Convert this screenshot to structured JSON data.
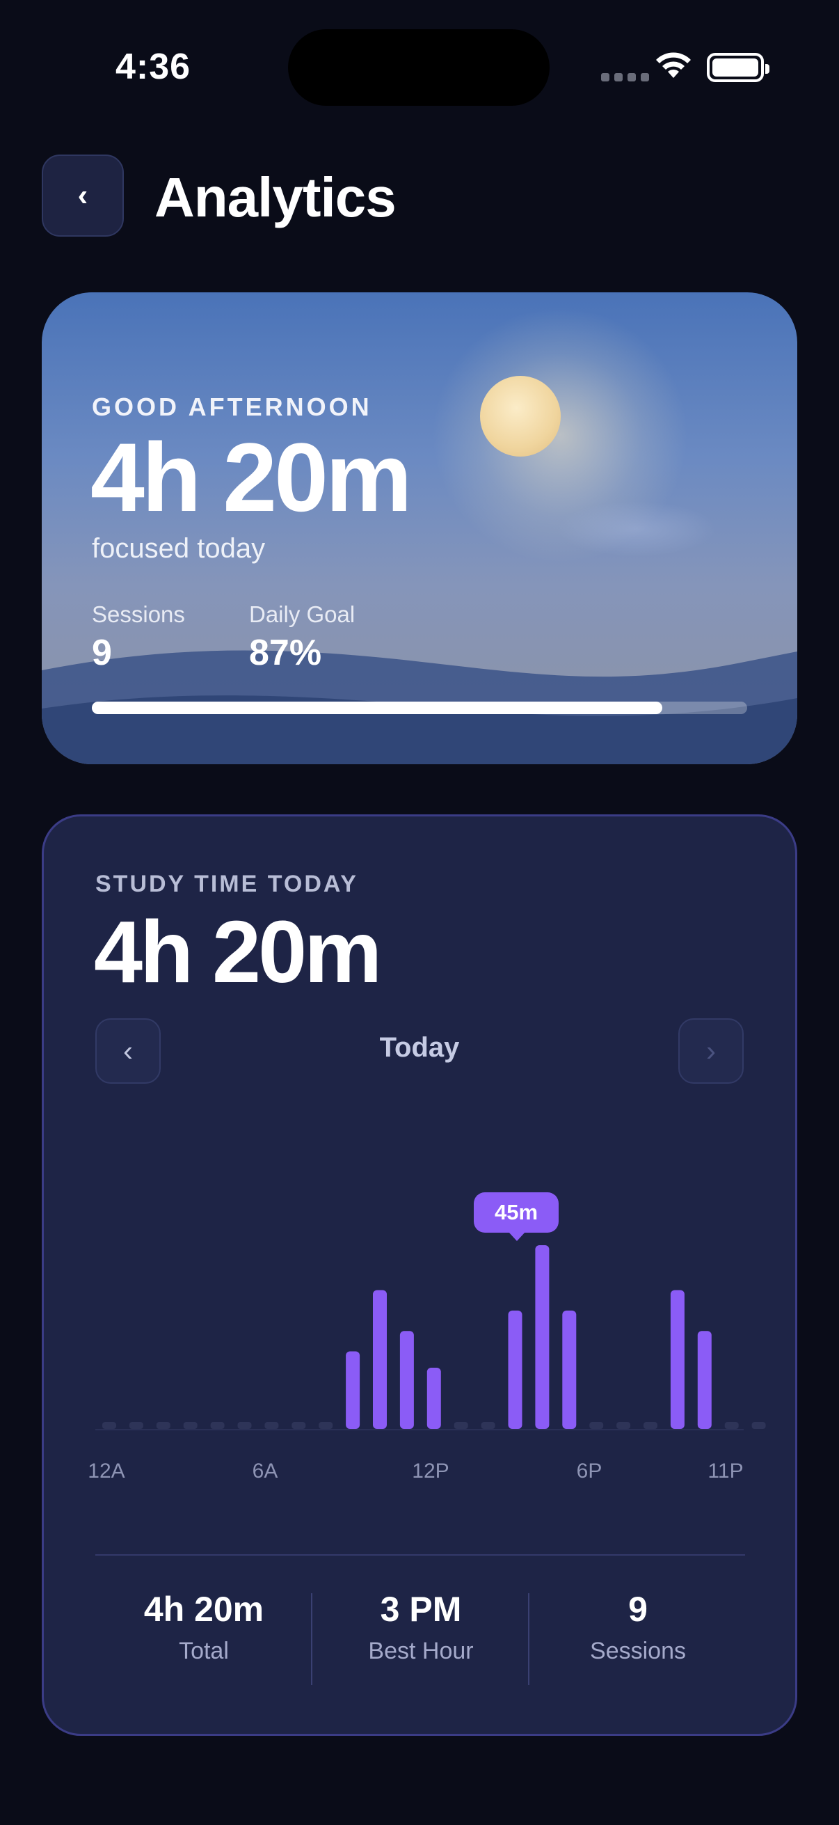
{
  "status_bar": {
    "time": "4:36"
  },
  "header": {
    "back_icon": "chevron-left-icon",
    "title": "Analytics"
  },
  "hero": {
    "greeting": "GOOD AFTERNOON",
    "focused_time": "4h 20m",
    "subtitle": "focused today",
    "stats": [
      {
        "label": "Sessions",
        "value": "9"
      },
      {
        "label": "Daily Goal",
        "value": "87%"
      }
    ],
    "goal_progress": 0.87
  },
  "study": {
    "label": "STUDY TIME TODAY",
    "total": "4h 20m",
    "period": "Today",
    "tooltip": "45m",
    "summary": [
      {
        "value": "4h 20m",
        "label": "Total"
      },
      {
        "value": "3 PM",
        "label": "Best Hour"
      },
      {
        "value": "9",
        "label": "Sessions"
      }
    ]
  },
  "chart_data": {
    "type": "bar",
    "categories": [
      "12A",
      "1A",
      "2A",
      "3A",
      "4A",
      "5A",
      "6A",
      "7A",
      "8A",
      "9A",
      "10A",
      "11A",
      "12P",
      "1P",
      "2P",
      "3P",
      "4P",
      "5P",
      "6P",
      "7P",
      "8P",
      "9P",
      "10P",
      "11P"
    ],
    "values": [
      0,
      0,
      0,
      0,
      0,
      0,
      0,
      0,
      0,
      19,
      34,
      24,
      15,
      0,
      0,
      29,
      45,
      29,
      0,
      0,
      0,
      34,
      24,
      0,
      0
    ],
    "unit": "minutes",
    "tick_labels": [
      "12A",
      "6A",
      "12P",
      "6P",
      "11P"
    ],
    "highlight_category": "4P",
    "highlight_label": "45m",
    "ylim": [
      0,
      45
    ],
    "colors": {
      "bar": "#8b5cf6",
      "empty": "#2e3458"
    }
  }
}
